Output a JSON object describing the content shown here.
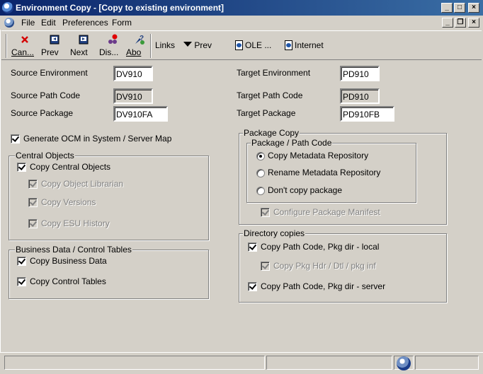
{
  "window": {
    "title": "Environment Copy - [Copy to existing environment]",
    "controls": {
      "minimize": "_",
      "maximize": "□",
      "close": "×"
    }
  },
  "menu": {
    "items": [
      "File",
      "Edit",
      "Preferences",
      "Form"
    ],
    "mdi_controls": {
      "minimize": "_",
      "restore": "❐",
      "close": "×"
    }
  },
  "toolbar": {
    "cancel_label": "Can...",
    "prev_label": "Prev",
    "next_label": "Next",
    "display_label": "Dis...",
    "about_label": "Abo",
    "links_label": "Links",
    "links_prev_label": "Prev",
    "ole_label": "OLE ...",
    "internet_label": "Internet"
  },
  "form": {
    "source_env_label": "Source Environment",
    "source_env_value": "DV910",
    "source_path_label": "Source Path Code",
    "source_path_value": "DV910",
    "source_pkg_label": "Source Package",
    "source_pkg_value": "DV910FA",
    "target_env_label": "Target Environment",
    "target_env_value": "PD910",
    "target_path_label": "Target Path Code",
    "target_path_value": "PD910",
    "target_pkg_label": "Target Package",
    "target_pkg_value": "PD910FB",
    "generate_ocm_label": "Generate OCM in System / Server Map",
    "central_objects": {
      "title": "Central Objects",
      "copy_central": "Copy Central Objects",
      "copy_librarian": "Copy Object Librarian",
      "copy_versions": "Copy Versions",
      "copy_esu": "Copy ESU History"
    },
    "business_data": {
      "title": "Business Data / Control Tables",
      "copy_business": "Copy Business Data",
      "copy_control": "Copy Control Tables"
    },
    "package_copy": {
      "title": "Package Copy",
      "sub_title": "Package / Path Code",
      "options": [
        "Copy Metadata Repository",
        "Rename Metadata Repository",
        "Don't copy package"
      ],
      "selected_option": "Copy Metadata Repository",
      "configure_manifest": "Configure Package Manifest"
    },
    "directory_copies": {
      "title": "Directory copies",
      "copy_local": "Copy Path Code, Pkg dir - local",
      "copy_pkg_hdr": "Copy Pkg Hdr / Dtl / pkg inf",
      "copy_server": "Copy Path Code, Pkg dir - server"
    }
  },
  "icons": {
    "cancel": "x-icon",
    "prev": "prev-page-icon",
    "next": "next-page-icon",
    "display": "display-icon",
    "about": "about-icon",
    "links_arrow": "triangle-down-icon",
    "ole": "page-icon",
    "internet": "page-icon",
    "status": "globe-icon"
  },
  "colors": {
    "titlebar_start": "#0a246a",
    "titlebar_end": "#3a6ea5",
    "face": "#d4d0c8",
    "disabled_text": "#808080",
    "cancel_red": "#d40000"
  }
}
